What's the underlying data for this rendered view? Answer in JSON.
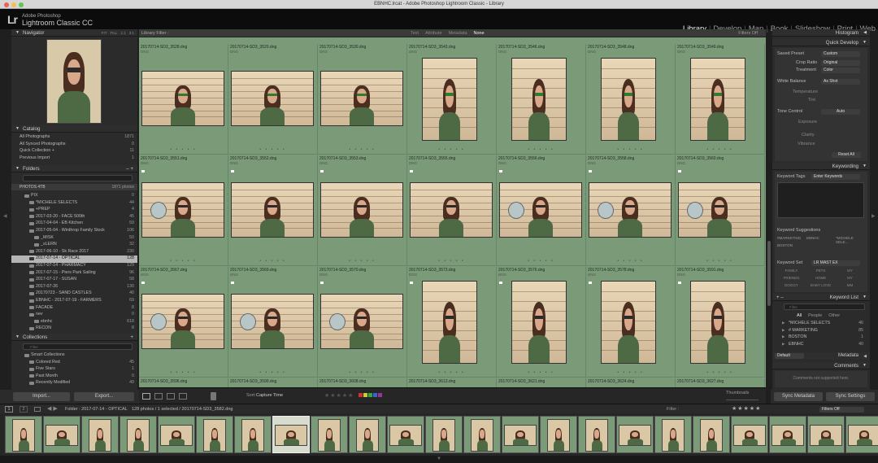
{
  "window": {
    "title": "EBNHC.lrcat - Adobe Photoshop Lightroom Classic - Library"
  },
  "identity": {
    "logo": "Lr",
    "company": "Adobe Photoshop",
    "product": "Lightroom Classic CC"
  },
  "modules": [
    {
      "label": "Library",
      "active": true
    },
    {
      "label": "Develop"
    },
    {
      "label": "Map"
    },
    {
      "label": "Book"
    },
    {
      "label": "Slideshow"
    },
    {
      "label": "Print"
    },
    {
      "label": "Web"
    }
  ],
  "left": {
    "navigator": {
      "title": "Navigator",
      "zoom": [
        "FIT",
        "FILL",
        "1:1",
        "3:1"
      ]
    },
    "catalog": {
      "title": "Catalog",
      "items": [
        {
          "name": "All Photographs",
          "count": "1871"
        },
        {
          "name": "All Synced Photographs",
          "count": "0"
        },
        {
          "name": "Quick Collection +",
          "count": "11"
        },
        {
          "name": "Previous Import",
          "count": "1"
        }
      ]
    },
    "folders": {
      "title": "Folders",
      "volume": "PHOTOS 4TB",
      "volume_info": "1871 photos",
      "items": [
        {
          "name": "PIX",
          "count": "0",
          "indent": 1
        },
        {
          "name": "*MICHELE SELECTS",
          "count": "44",
          "indent": 2
        },
        {
          "name": "+PREP",
          "count": "4",
          "indent": 2
        },
        {
          "name": "2017-03-20 - FACE 500th",
          "count": "45",
          "indent": 2
        },
        {
          "name": "2017-04-04 - EB Kitchen",
          "count": "59",
          "indent": 2
        },
        {
          "name": "2017-05-04 - Winthrop Family Stock",
          "count": "106",
          "indent": 2
        },
        {
          "name": "_MISK",
          "count": "50",
          "indent": 3
        },
        {
          "name": "_xLERN",
          "count": "32",
          "indent": 3
        },
        {
          "name": "2017-06-10 - Sk Race 2017",
          "count": "230",
          "indent": 2
        },
        {
          "name": "2017-07-14 - OPTICAL",
          "count": "128",
          "indent": 2,
          "selected": true
        },
        {
          "name": "2017-07-14 - PHARMACY",
          "count": "129",
          "indent": 2
        },
        {
          "name": "2017-07-15 - Piers Park Sailing",
          "count": "96",
          "indent": 2
        },
        {
          "name": "2017-07-17 - SUSAN",
          "count": "58",
          "indent": 2
        },
        {
          "name": "2017-07-26",
          "count": "130",
          "indent": 2
        },
        {
          "name": "20170723 - SAND CASTLES",
          "count": "40",
          "indent": 2
        },
        {
          "name": "EBNHC - 2017-07-19 - FARMERS",
          "count": "69",
          "indent": 2
        },
        {
          "name": "FACADE",
          "count": "8",
          "indent": 2
        },
        {
          "name": "nev",
          "count": "0",
          "indent": 2
        },
        {
          "name": "ebnhc",
          "count": "618",
          "indent": 3
        },
        {
          "name": "RECON",
          "count": "8",
          "indent": 2
        }
      ]
    },
    "collections": {
      "title": "Collections",
      "search_placeholder": "Filter",
      "items": [
        {
          "name": "Smart Collections",
          "count": "",
          "indent": 1
        },
        {
          "name": "Colored Red",
          "count": "45",
          "indent": 2
        },
        {
          "name": "Five Stars",
          "count": "1",
          "indent": 2
        },
        {
          "name": "Past Month",
          "count": "0",
          "indent": 2
        },
        {
          "name": "Recently Modified",
          "count": "49",
          "indent": 2
        }
      ]
    },
    "import_label": "Import...",
    "export_label": "Export..."
  },
  "filter_bar": {
    "title": "Library Filter :",
    "options": [
      "Text",
      "Attribute",
      "Metadata",
      "None"
    ],
    "active": "None",
    "right": "Filters Off"
  },
  "grid": {
    "rows": [
      [
        {
          "file": "20170714-SD3_3528.dng",
          "size": "DNG",
          "orient": "h",
          "glasses": "green"
        },
        {
          "file": "20170714-SD3_3529.dng",
          "size": "DNG",
          "orient": "h",
          "glasses": "green"
        },
        {
          "file": "20170714-SD3_3530.dng",
          "size": "DNG",
          "orient": "h",
          "glasses": "green"
        },
        {
          "file": "20170714-SD3_3543.dng",
          "size": "DNG",
          "orient": "v",
          "glasses": "green"
        },
        {
          "file": "20170714-SD3_3546.dng",
          "size": "DNG",
          "orient": "v",
          "glasses": "green"
        },
        {
          "file": "20170714-SD3_3548.dng",
          "size": "DNG",
          "orient": "v",
          "glasses": "green"
        },
        {
          "file": "20170714-SD3_3549.dng",
          "size": "DNG",
          "orient": "v",
          "glasses": "green"
        }
      ],
      [
        {
          "file": "20170714-SD3_3551.dng",
          "size": "DNG",
          "orient": "h",
          "glasses": "dark",
          "mirror": true
        },
        {
          "file": "20170714-SD3_3552.dng",
          "size": "DNG",
          "orient": "h",
          "glasses": "dark"
        },
        {
          "file": "20170714-SD3_3553.dng",
          "size": "DNG",
          "orient": "h",
          "glasses": "dark"
        },
        {
          "file": "20170714-SD3_3555.dng",
          "size": "DNG",
          "orient": "h",
          "glasses": "dark"
        },
        {
          "file": "20170714-SD3_3556.dng",
          "size": "DNG",
          "orient": "h",
          "glasses": "dark",
          "mirror": true
        },
        {
          "file": "20170714-SD3_3558.dng",
          "size": "DNG",
          "orient": "h",
          "glasses": "dark",
          "mirror": true
        },
        {
          "file": "20170714-SD3_3560.dng",
          "size": "DNG",
          "orient": "h",
          "glasses": "dark",
          "mirror": true
        }
      ],
      [
        {
          "file": "20170714-SD3_3567.dng",
          "size": "DNG",
          "orient": "h",
          "glasses": "dark",
          "mirror": true
        },
        {
          "file": "20170714-SD3_3569.dng",
          "size": "DNG",
          "orient": "h",
          "glasses": "dark",
          "mirror": true
        },
        {
          "file": "20170714-SD3_3570.dng",
          "size": "DNG",
          "orient": "h",
          "glasses": "dark",
          "mirror": true
        },
        {
          "file": "20170714-SD3_3573.dng",
          "size": "DNG",
          "orient": "v",
          "glasses": "dark"
        },
        {
          "file": "20170714-SD3_3576.dng",
          "size": "DNG",
          "orient": "v",
          "glasses": "dark"
        },
        {
          "file": "20170714-SD3_3578.dng",
          "size": "DNG",
          "orient": "v",
          "glasses": "dark"
        },
        {
          "file": "20170714-SD3_3591.dng",
          "size": "DNG",
          "orient": "v",
          "glasses": "dark"
        }
      ],
      [
        {
          "file": "20170714-SD3_3596.dng"
        },
        {
          "file": "20170714-SD3_3599.dng"
        },
        {
          "file": "20170714-SD3_3608.dng"
        },
        {
          "file": "20170714-SD3_3613.dng"
        },
        {
          "file": "20170714-SD3_3621.dng"
        },
        {
          "file": "20170714-SD3_3624.dng"
        },
        {
          "file": "20170714-SD3_3627.dng"
        }
      ]
    ]
  },
  "toolbar": {
    "sort_label": "Sort:",
    "sort_value": "Capture Time",
    "thumbnails_label": "Thumbnails"
  },
  "right": {
    "histogram": "Histogram",
    "quick_develop": {
      "title": "Quick Develop",
      "saved_preset": {
        "label": "Saved Preset",
        "value": "Custom"
      },
      "crop_ratio": {
        "label": "Crop Ratio",
        "value": "Original"
      },
      "treatment": {
        "label": "Treatment",
        "value": "Color"
      },
      "white_balance": {
        "label": "White Balance",
        "value": "As Shot"
      },
      "temperature": "Temperature",
      "tint": "Tint",
      "tone_control": {
        "label": "Tone Control",
        "value": "Auto"
      },
      "exposure": "Exposure",
      "clarity": "Clarity",
      "vibrance": "Vibrance",
      "reset": "Reset All"
    },
    "keywording": {
      "title": "Keywording",
      "tags_label": "Keyword Tags",
      "tags_value": "Enter Keywords",
      "suggestions_label": "Keyword Suggestions",
      "suggestions": [
        "#MARKETING",
        "EBNHC",
        "*MICHELE SELE...",
        "BOSTON"
      ],
      "set_label": "Keyword Set",
      "set_value": "LR MAST EX",
      "set_items": [
        "FAMILY",
        "PETS",
        "MY",
        "FRIENDS",
        "HOME",
        "MY",
        "DOGGY",
        "BABY LOVE",
        "MM"
      ]
    },
    "keyword_list": {
      "title": "Keyword List",
      "filter_placeholder": "Filter",
      "tabs": [
        "All",
        "People",
        "Other"
      ],
      "items": [
        {
          "name": "*MICHELE SELECTS",
          "count": "46"
        },
        {
          "name": "# MARKETING",
          "count": "85"
        },
        {
          "name": "BOSTON",
          "count": "1"
        },
        {
          "name": "EBNHC",
          "count": "40"
        }
      ]
    },
    "metadata": {
      "title": "Metadata",
      "preset": "Default"
    },
    "comments": {
      "title": "Comments",
      "text": "Comments not supported here."
    },
    "sync_metadata": "Sync Metadata",
    "sync_settings": "Sync Settings"
  },
  "filmstrip_bar": {
    "pages": [
      "1",
      "2"
    ],
    "folder_label": "Folder : 2017-07-14 - OPTICAL",
    "count_text": "128 photos / 1 selected / 20170714-SD3_3582.dng",
    "filter_label": "Filter :",
    "filter_value": "Filters Off"
  },
  "colors": {
    "accent": "#7a9a78",
    "panel": "#2b2b2b"
  }
}
